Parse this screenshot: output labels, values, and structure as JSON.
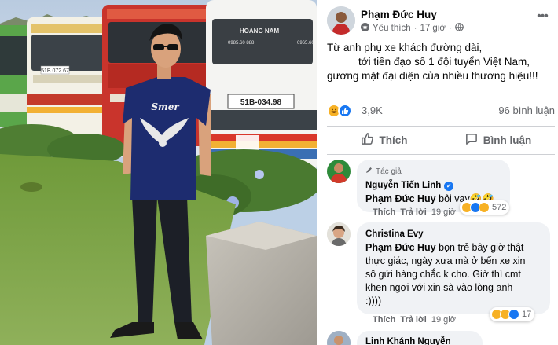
{
  "post": {
    "author": "Phạm Đức Huy",
    "meta_like": "Yêu thích",
    "meta_time": "17 giờ",
    "more_icon": "more-horizontal-icon",
    "text_lines": [
      "Từ anh phụ xe khách đường dài,",
      "tới tiền đạo số 1 đội tuyển Việt Nam,",
      "gương mặt đại diện của nhiều thương hiệu!!!"
    ],
    "reaction_count": "3,9K",
    "comment_count": "96 bình luận",
    "like_label": "Thích",
    "comment_label": "Bình luận"
  },
  "photo": {
    "bus_sign_1": "HOANG NAM",
    "bus_plate_1": "51B-034.98",
    "bus_phone_1": "0965.60",
    "bus_phone_2": "0985.60 888",
    "bus_plate_left": "51B 072.67",
    "shirt_text": "Smer"
  },
  "comments": [
    {
      "badge": "Tác giả",
      "name": "Nguyễn Tiến Linh",
      "verified": true,
      "mention": "Phạm Đức Huy",
      "lines": [
        " bôi vạy🤣🤣"
      ],
      "like": "Thích",
      "reply": "Trả lời",
      "time": "19 giờ",
      "reaction_count": "572"
    },
    {
      "name": "Christina Evy",
      "mention": "Phạm Đức Huy",
      "lines": [
        " bọn trẻ bây giờ thật",
        "thực giác, ngày xưa mà ở bến xe xin",
        "số gửi hàng chắc k cho. Giờ thì cmt",
        "khen ngợi với xin sà vào lòng anh",
        ":))))"
      ],
      "like": "Thích",
      "reply": "Trả lời",
      "time": "19 giờ",
      "reaction_count": "17"
    },
    {
      "name": "Linh Khánh Nguyễn"
    }
  ],
  "colors": {
    "facebook_blue": "#1877f2",
    "bubble_gray": "#f0f2f5",
    "secondary_text": "#65676b"
  }
}
